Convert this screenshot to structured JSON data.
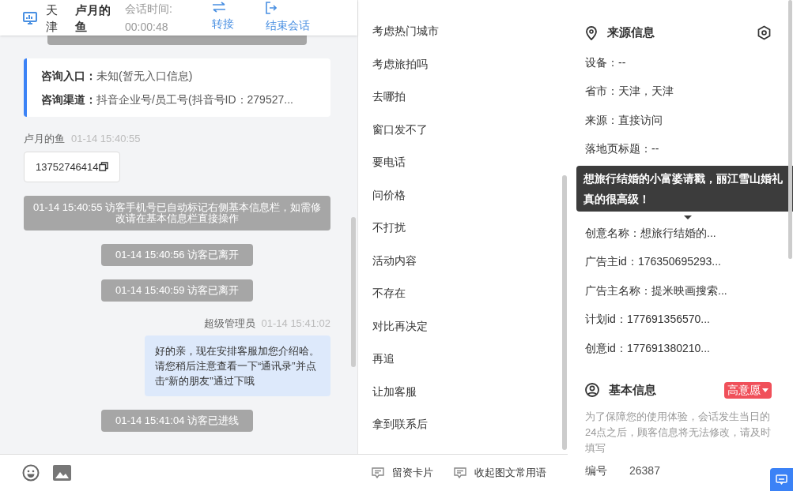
{
  "header": {
    "city": "天津",
    "visitor": "卢月的鱼",
    "timer_label": "会话时间:",
    "timer": "00:00:48",
    "actions": [
      {
        "kind": "transfer",
        "label": "转接"
      },
      {
        "kind": "end",
        "label": "结束会话"
      }
    ]
  },
  "entry_card": [
    {
      "label": "咨询入口：",
      "value": "未知(暂无入口信息)"
    },
    {
      "label": "咨询渠道：",
      "value": "抖音企业号/员工号(抖音号ID：279527..."
    }
  ],
  "messages": [
    {
      "kind": "visitor",
      "sender": "卢月的鱼",
      "time": "01-14 15:40:55",
      "text": "13752746414"
    },
    {
      "kind": "system",
      "text": "01-14 15:40:55 访客手机号已自动标记右侧基本信息栏，如需修改请在基本信息栏直接操作"
    },
    {
      "kind": "system",
      "text": "01-14 15:40:56 访客已离开"
    },
    {
      "kind": "system",
      "text": "01-14 15:40:59 访客已离开"
    },
    {
      "kind": "agent",
      "sender": "超级管理员",
      "time": "01-14 15:41:02",
      "text": "好的亲，现在安排客服加您介绍哈。请您稍后注意查看一下“通讯录”并点击“新的朋友”通过下哦"
    },
    {
      "kind": "system",
      "text": "01-14 15:41:04 访客已进线"
    }
  ],
  "quick_replies": [
    "考虑热门城市",
    "考虑旅拍吗",
    "去哪拍",
    "窗口发不了",
    "要电话",
    "问价格",
    "不打扰",
    "活动内容",
    "不存在",
    "对比再决定",
    "再追",
    "让加客服",
    "拿到联系后"
  ],
  "bottom_actions": [
    "留资卡片",
    "收起图文常用语"
  ],
  "source_info": {
    "title": "来源信息",
    "rows_top": [
      "设备：--",
      "省市：天津，天津",
      "来源：直接访问",
      "落地页标题：--"
    ],
    "tooltip": "想旅行结婚的小富婆请戳，丽江雪山婚礼真的很高级！",
    "rows_bottom": [
      "创意名称：想旅行结婚的...",
      "广告主id：176350695293...",
      "广告主名称：提米映画搜索...",
      "计划id：177691356570...",
      "创意id：177691380210..."
    ]
  },
  "basic_info": {
    "title": "基本信息",
    "intent": "高意愿",
    "notice": "为了保障您的使用体验，会话发生当日的24点之后，顾客信息将无法修改，请及时填写",
    "fields": [
      {
        "label": "编号",
        "value": "26387"
      }
    ]
  }
}
